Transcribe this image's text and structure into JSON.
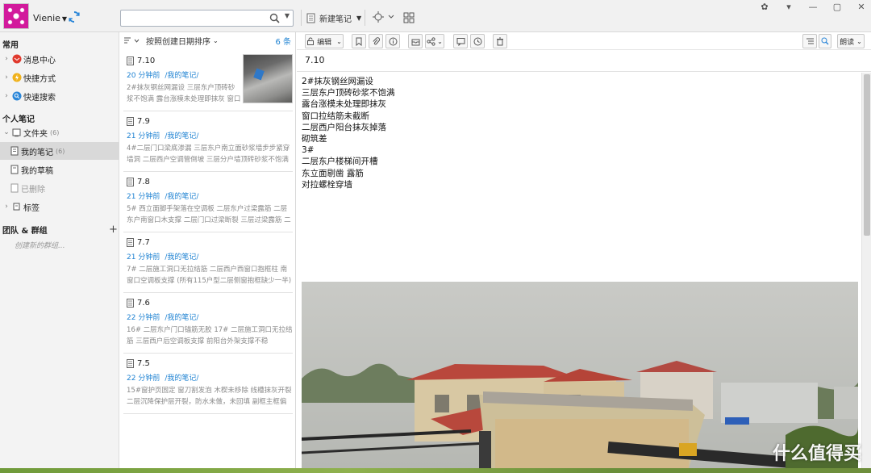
{
  "user": {
    "name": "Vienie"
  },
  "search": {
    "value": "",
    "placeholder": ""
  },
  "toolbar": {
    "new_note_label": "新建笔记"
  },
  "sidebar": {
    "section_common": "常用",
    "items_common": [
      {
        "label": "消息中心"
      },
      {
        "label": "快捷方式"
      },
      {
        "label": "快速搜索"
      }
    ],
    "section_personal": "个人笔记",
    "folder": {
      "label": "文件夹",
      "count": "(6)"
    },
    "my_notes": {
      "label": "我的笔记",
      "count": "(6)"
    },
    "drafts": {
      "label": "我的草稿"
    },
    "deleted": {
      "label": "已删除"
    },
    "tags": {
      "label": "标签"
    },
    "section_team": "团队 & 群组",
    "team_hint": "创建新的群组..."
  },
  "list": {
    "sort_label": "按照创建日期排序",
    "count": "6 条",
    "notes": [
      {
        "title": "7.10",
        "time": "20 分钟前",
        "folder": "/我的笔记/",
        "snippet": "2#抹灰钢丝网漏设 三层东户顶砖砂浆不饱满 露台涨模未处理即抹灰 窗口拉结..."
      },
      {
        "title": "7.9",
        "time": "21 分钟前",
        "folder": "/我的笔记/",
        "snippet": "4#二层门口梁底渗漏 三层东户南立面砂浆墙步步紧穿墙洞 二层西户空调管倒坡 三层分户墙顶砖砂浆不饱满"
      },
      {
        "title": "7.8",
        "time": "21 分钟前",
        "folder": "/我的笔记/",
        "snippet": "5# 西立面脚手架落在空调板 二层东户过梁露筋 二层东户南窗口木支撑 二层门口过梁断裂 三层过梁露筋 二层西户..."
      },
      {
        "title": "7.7",
        "time": "21 分钟前",
        "folder": "/我的笔记/",
        "snippet": "7# 二层施工洞口无拉结筋 二层西户西窗口抱框柱 南窗口空调板支撑 (所有115户型二层侧窗抱框缺少一半) 二层..."
      },
      {
        "title": "7.6",
        "time": "22 分钟前",
        "folder": "/我的笔记/",
        "snippet": "16# 二层东户门口锚筋无胶 17# 二层施工洞口无拉结筋 三层西户后空调板支撑 前阳台外架支撑不稳"
      },
      {
        "title": "7.5",
        "time": "22 分钟前",
        "folder": "/我的笔记/",
        "snippet": "15#窗护页固定 窗刀割发泡 木楔未移除 线槽抹灰开裂 二层沉降保护层开裂，防水未做，未回填 副框主框偏位"
      }
    ]
  },
  "editor": {
    "edit_label": "编辑",
    "read_label": "朗读",
    "title": "7.10",
    "lines": [
      "2#抹灰钢丝网漏设",
      "三层东户顶砖砂浆不饱满",
      "露台涨模未处理即抹灰",
      "窗口拉结筋未截断",
      "二层西户阳台抹灰掉落",
      "砌筑差",
      "3#",
      "二层东户楼梯间开槽",
      "东立面剔凿 露筋",
      "对拉螺栓穿墙"
    ]
  },
  "watermark": "什么值得买",
  "colors": {
    "accent": "#1e82d2",
    "avatar": "#d21a9c",
    "sync": "#2a86d8"
  }
}
